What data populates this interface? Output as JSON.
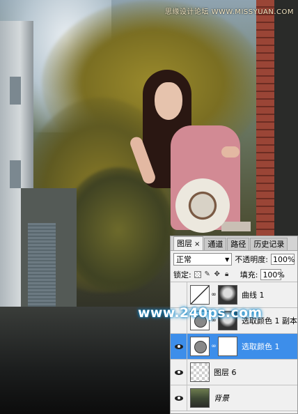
{
  "watermarks": {
    "top": "思缘设计论坛 WWW.MISSYUAN.COM",
    "center": "www.240ps.com"
  },
  "layers_panel": {
    "tabs": [
      {
        "label": "图层",
        "active": true,
        "close": "×"
      },
      {
        "label": "通道",
        "active": false
      },
      {
        "label": "路径",
        "active": false
      },
      {
        "label": "历史记录",
        "active": false
      }
    ],
    "blend_mode": "正常",
    "opacity_label": "不透明度:",
    "opacity_value": "100%",
    "lock_label": "锁定:",
    "fill_label": "填充:",
    "fill_value": "100%",
    "layers": [
      {
        "name": "曲线 1",
        "visible": false,
        "selected": false,
        "thumb": "curve-adjustment",
        "mask": true
      },
      {
        "name": "选取颜色 1 副本",
        "visible": false,
        "selected": false,
        "thumb": "adjustment",
        "mask": true
      },
      {
        "name": "选取颜色 1",
        "visible": true,
        "selected": true,
        "thumb": "adjustment",
        "mask": true
      },
      {
        "name": "图层 6",
        "visible": true,
        "selected": false,
        "thumb": "transparent",
        "mask": false
      },
      {
        "name": "背景",
        "visible": true,
        "selected": false,
        "thumb": "photo",
        "mask": false
      }
    ]
  },
  "colors": {
    "selected_layer": "#3d8eea",
    "watermark_glow": "#0a84c8"
  }
}
